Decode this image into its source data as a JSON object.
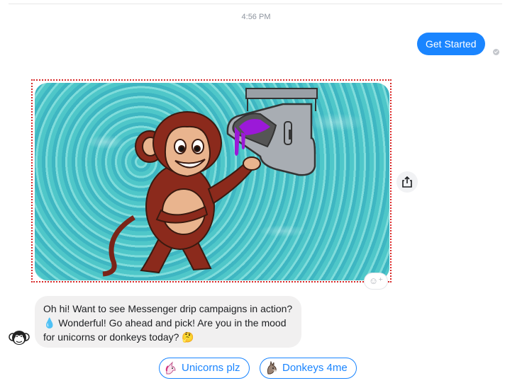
{
  "conversation": {
    "timestamp": "4:56 PM",
    "sent_message": "Get Started",
    "received_message": "Oh hi! Want to see Messenger drip campaigns in action? 💧 Wonderful! Go ahead and pick! Are you in the mood for unicorns or donkeys today? 🤔",
    "quick_replies": [
      {
        "label": "Unicorns plz",
        "icon": "unicorn-icon"
      },
      {
        "label": "Donkeys 4me",
        "icon": "donkey-icon"
      }
    ]
  },
  "image_card": {
    "subject": "monkey-pointing-at-faucet-dripping-purple",
    "background": "water"
  },
  "icons": {
    "share": "share-icon",
    "react": "emoji-react-icon",
    "read_receipt": "check-icon",
    "avatar": "monkey-avatar-icon"
  },
  "colors": {
    "accent": "#1a85ff",
    "received_bubble": "#f1f0f0",
    "selection_outline": "#d62828"
  }
}
